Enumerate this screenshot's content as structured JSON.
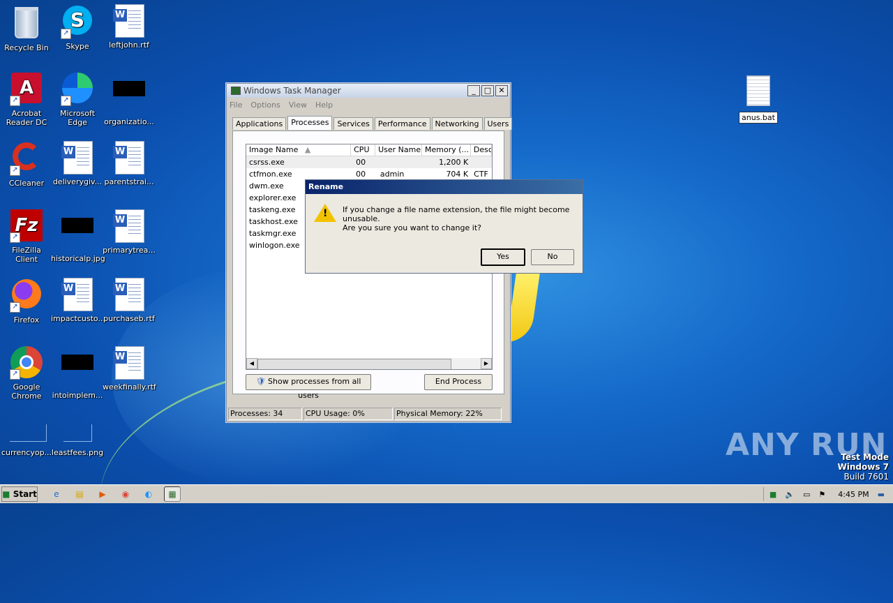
{
  "desktop": {
    "icons": [
      {
        "label": "Recycle Bin",
        "icon": "recycle-bin-icon"
      },
      {
        "label": "Skype",
        "icon": "skype-icon"
      },
      {
        "label": "leftjohn.rtf",
        "icon": "word-doc-icon"
      },
      {
        "label": "Acrobat\nReader DC",
        "icon": "acrobat-icon"
      },
      {
        "label": "Microsoft Edge",
        "icon": "edge-icon"
      },
      {
        "label": "organizatio...",
        "icon": "blacked-out-icon"
      },
      {
        "label": "CCleaner",
        "icon": "ccleaner-icon"
      },
      {
        "label": "deliverygiv...",
        "icon": "word-doc-icon"
      },
      {
        "label": "parentstrai...",
        "icon": "word-doc-icon"
      },
      {
        "label": "FileZilla Client",
        "icon": "filezilla-icon"
      },
      {
        "label": "historicalp.jpg",
        "icon": "blacked-out-icon"
      },
      {
        "label": "primarytrea...",
        "icon": "word-doc-icon"
      },
      {
        "label": "Firefox",
        "icon": "firefox-icon"
      },
      {
        "label": "impactcusto...",
        "icon": "word-doc-icon"
      },
      {
        "label": "purchaseb.rtf",
        "icon": "word-doc-icon"
      },
      {
        "label": "Google\nChrome",
        "icon": "chrome-icon"
      },
      {
        "label": "intoimplem...",
        "icon": "blacked-out-icon"
      },
      {
        "label": "weekfinally.rtf",
        "icon": "word-doc-icon"
      },
      {
        "label": "currencyop...",
        "icon": "blank-file-icon"
      },
      {
        "label": "leastfees.png",
        "icon": "blank-file-icon"
      }
    ],
    "selected_file": "anus.bat"
  },
  "taskmgr": {
    "title": "Windows Task Manager",
    "menu": [
      "File",
      "Options",
      "View",
      "Help"
    ],
    "tabs": [
      "Applications",
      "Processes",
      "Services",
      "Performance",
      "Networking",
      "Users"
    ],
    "active_tab": "Processes",
    "columns": [
      "Image Name",
      "CPU",
      "User Name",
      "Memory (...",
      "Desc"
    ],
    "rows": [
      [
        "csrss.exe",
        "00",
        "",
        "1,200 K",
        ""
      ],
      [
        "ctfmon.exe",
        "00",
        "admin",
        "704 K",
        "CTF"
      ],
      [
        "dwm.exe",
        "",
        "",
        "",
        ""
      ],
      [
        "explorer.exe",
        "",
        "",
        "",
        ""
      ],
      [
        "taskeng.exe",
        "",
        "",
        "",
        ""
      ],
      [
        "taskhost.exe",
        "",
        "",
        "",
        ""
      ],
      [
        "taskmgr.exe",
        "",
        "",
        "",
        ""
      ],
      [
        "winlogon.exe",
        "",
        "",
        "",
        ""
      ]
    ],
    "show_all_button": "Show processes from all users",
    "end_process_button": "End Process",
    "status": {
      "processes": "Processes: 34",
      "cpu": "CPU Usage: 0%",
      "memory": "Physical Memory: 22%"
    }
  },
  "dialog": {
    "title": "Rename",
    "message": "If you change a file name extension, the file might become unusable.",
    "question": "Are you sure you want to change it?",
    "yes": "Yes",
    "no": "No"
  },
  "watermark": "ANY RUN",
  "testmode": {
    "line1": "Test Mode",
    "line2": "Windows 7",
    "line3": "Build 7601"
  },
  "taskbar": {
    "start": "Start",
    "clock": "4:45 PM"
  }
}
